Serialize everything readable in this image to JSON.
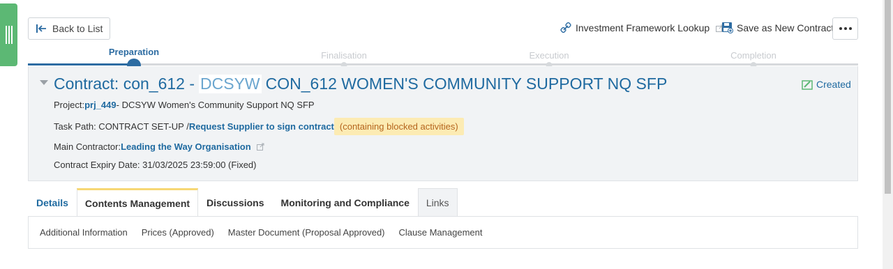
{
  "toolbar": {
    "back_label": "Back to List",
    "investment_lookup_label": "Investment Framework Lookup",
    "save_new_label": "Save as New Contract"
  },
  "progress": {
    "stages": [
      "Preparation",
      "Finalisation",
      "Execution",
      "Completion"
    ],
    "current_stage": "Preparation"
  },
  "contract": {
    "title_prefix": "Contract: con_612 -",
    "title_code": "DCSYW",
    "title_rest": "CON_612 WOMEN'S COMMUNITY SUPPORT NQ SFP",
    "status": "Created",
    "project_label": "Project:",
    "project_link": "prj_449",
    "project_rest": "- DCSYW Women's Community Support NQ SFP",
    "task_label": "Task Path: CONTRACT SET-UP /",
    "task_link": "Request Supplier to sign contract",
    "task_warning": "(containing blocked activities)",
    "contractor_label": "Main Contractor:",
    "contractor_link": "Leading the Way Organisation",
    "expiry": "Contract Expiry Date: 31/03/2025 23:59:00 (Fixed)"
  },
  "tabs": [
    "Details",
    "Contents Management",
    "Discussions",
    "Monitoring and Compliance",
    "Links"
  ],
  "active_tab": "Contents Management",
  "sub_links": [
    "Additional Information",
    "Prices (Approved)",
    "Master Document (Proposal Approved)",
    "Clause Management"
  ],
  "colors": {
    "accent": "#1f6aa0",
    "handle": "#5cb874",
    "warning_bg": "#fcebb3",
    "active_tab_top": "#f7d774"
  }
}
